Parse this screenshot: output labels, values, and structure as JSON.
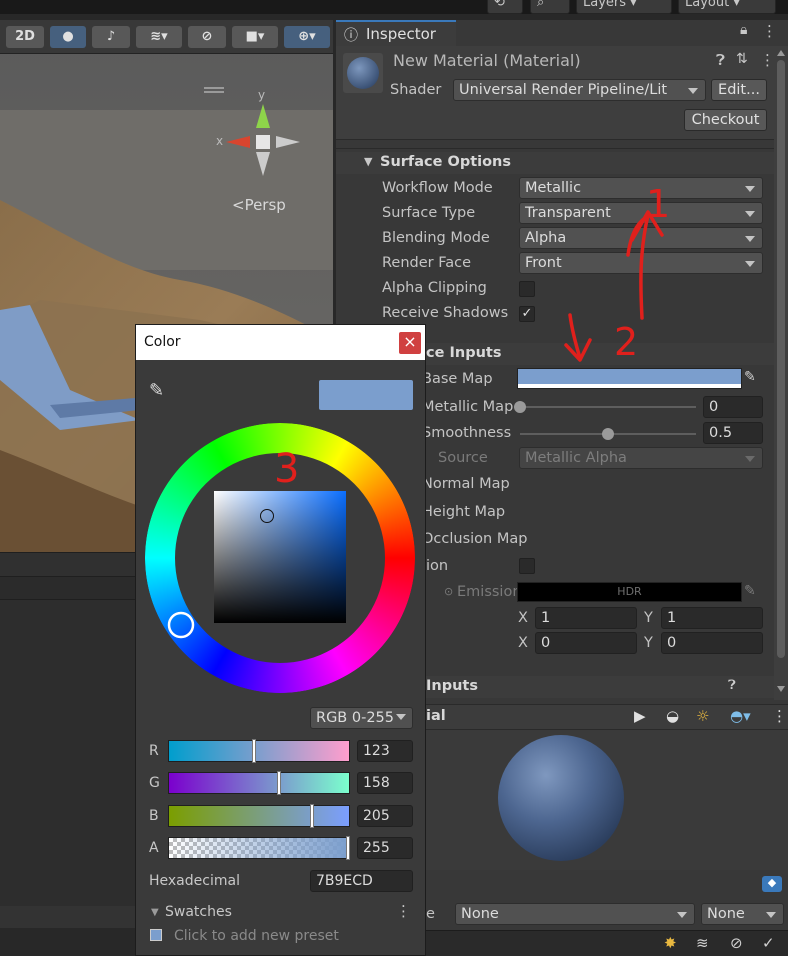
{
  "topbar": {
    "layers": "Layers",
    "layout": "Layout"
  },
  "scene": {
    "mode_2d": "2D",
    "axis_y": "y",
    "axis_x": "x",
    "persp": "<Persp"
  },
  "inspector": {
    "tab": "Inspector",
    "material_name": "New Material (Material)",
    "shader_label": "Shader",
    "shader_value": "Universal Render Pipeline/Lit",
    "edit_button": "Edit...",
    "checkout_button": "Checkout",
    "surface_options_header": "Surface Options",
    "props": [
      {
        "label": "Workflow Mode",
        "value": "Metallic"
      },
      {
        "label": "Surface Type",
        "value": "Transparent"
      },
      {
        "label": "Blending Mode",
        "value": "Alpha"
      },
      {
        "label": "Render Face",
        "value": "Front"
      }
    ],
    "alpha_clipping": "Alpha Clipping",
    "receive_shadows": "Receive Shadows",
    "receive_shadows_check": "✓",
    "surface_inputs_header": "ce Inputs",
    "base_map": "Base Map",
    "base_map_color": "#7B9ECD",
    "metallic_map": "Metallic Map",
    "metallic_value": "0",
    "metallic_fraction": 0,
    "smoothness": "Smoothness",
    "smoothness_value": "0.5",
    "smoothness_fraction": 0.5,
    "source_label": "Source",
    "source_value": "Metallic Alpha",
    "normal_map": "Normal Map",
    "height_map": "Height Map",
    "occlusion_map": "Occlusion Map",
    "emission_label": "ion",
    "emission_sub": "Emission",
    "hdr": "HDR",
    "tiling": {
      "x_label": "X",
      "x": "1",
      "y_label": "Y",
      "y": "1"
    },
    "offset": {
      "x_label": "X",
      "x": "0",
      "y_label": "Y",
      "y": "0"
    },
    "detail_inputs_header": "Inputs",
    "preview_label": "ial",
    "bottom_none1": "None",
    "bottom_none2": "None",
    "bottom_e": "e"
  },
  "annotations": {
    "one": "1",
    "two": "2",
    "three": "3"
  },
  "color_picker": {
    "title": "Color",
    "close": "×",
    "preview_color": "#7B9ECD",
    "mode": "RGB 0-255",
    "channels": [
      {
        "label": "R",
        "value": "123",
        "fraction": 0.482
      },
      {
        "label": "G",
        "value": "158",
        "fraction": 0.62
      },
      {
        "label": "B",
        "value": "205",
        "fraction": 0.804
      },
      {
        "label": "A",
        "value": "255",
        "fraction": 1
      }
    ],
    "hex_label": "Hexadecimal",
    "hex_value": "7B9ECD",
    "swatches_label": "Swatches",
    "swatches_hint": "Click to add new preset"
  }
}
